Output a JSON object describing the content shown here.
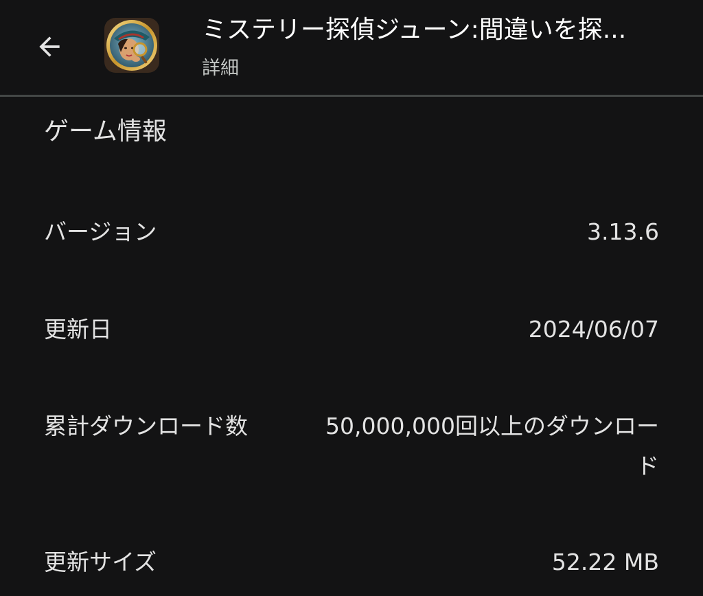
{
  "header": {
    "app_title": "ミステリー探偵ジューン:間違いを探...",
    "subtitle": "詳細"
  },
  "section": {
    "title": "ゲーム情報"
  },
  "rows": [
    {
      "label": "バージョン",
      "value": "3.13.6"
    },
    {
      "label": "更新日",
      "value": "2024/06/07"
    },
    {
      "label": "累計ダウンロード数",
      "value": "50,000,000回以上のダウンロード"
    },
    {
      "label": "更新サイズ",
      "value": "52.22 MB"
    }
  ],
  "icons": {
    "back": "arrow-back-icon",
    "app": "app-icon"
  },
  "colors": {
    "background": "#131314",
    "text": "#e3e3e3",
    "secondary_text": "#c4c7c5",
    "divider": "#444746"
  }
}
